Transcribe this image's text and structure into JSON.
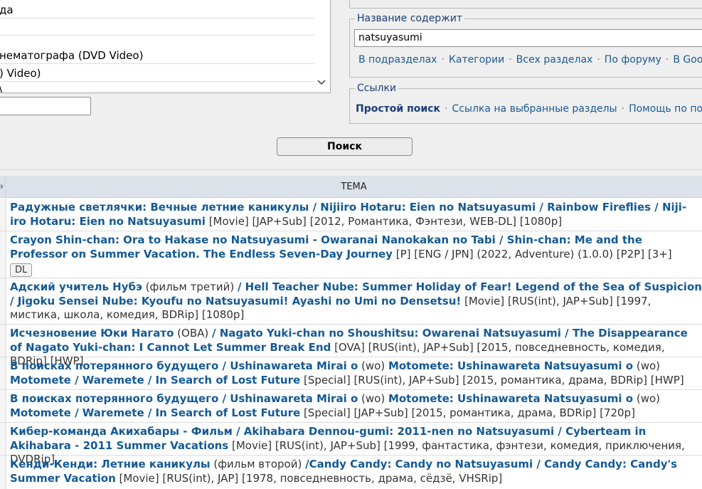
{
  "categories": {
    "items": [
      {
        "label": "да",
        "selected": false
      },
      {
        "label": "",
        "selected": false
      },
      {
        "label": "нематографа (DVD Video)",
        "selected": true
      },
      {
        "label": ") Video)",
        "selected": false
      },
      {
        "label": "\\",
        "selected": false
      }
    ]
  },
  "title_search": {
    "legend": "Название содержит",
    "value": "natsuyasumi",
    "scope_links": [
      "В подразделах",
      "Категории",
      "Всех разделах",
      "По форуму",
      "В Googl"
    ]
  },
  "links": {
    "legend": "Ссылки",
    "items": [
      "Простой поиск",
      "Ссылка на выбранные разделы",
      "Помощь по поис"
    ]
  },
  "search_button": "Поиск",
  "table": {
    "header": "ТЕМА",
    "rows": [
      {
        "parts": [
          {
            "t": "Радужные светлячки: Вечные летние каникулы / Nijiiro Hotaru: Eien no Natsuyasumi / Rainbow Fireflies / Niji-iro Hotaru: Eien no Natsuyasumi",
            "b": true
          },
          {
            "t": " [Movie] [JAP+Sub] [2012, Романтика, Фэнтези, WEB-DL] [1080p]",
            "b": false
          }
        ]
      },
      {
        "parts": [
          {
            "t": "Crayon Shin-chan: Ora to Hakase no Natsuyasumi - Owaranai Nanokakan no Tabi / Shin-chan: Me and the Professor on Summer Vacation. The Endless Seven-Day Journey",
            "b": true
          },
          {
            "t": " [P] [ENG / JPN] (2022, Adventure) (1.0.0) [P2P] [3+]",
            "b": false
          }
        ],
        "badge": "DL"
      },
      {
        "parts": [
          {
            "t": "Адский учитель Нубэ",
            "b": true
          },
          {
            "t": " (фильм третий) ",
            "b": false
          },
          {
            "t": "/ Hell Teacher Nube: Summer Holiday of Fear! Legend of the Sea of Suspicion / Jigoku Sensei Nube: Kyoufu no Natsuyasumi! Ayashi no Umi no Densetsu!",
            "b": true
          },
          {
            "t": " [Movie] [RUS(int), JAP+Sub] [1997, мистика, школа, комедия, BDRip] [1080p]",
            "b": false
          }
        ]
      },
      {
        "parts": [
          {
            "t": "Исчезновение Юки Нагато",
            "b": true
          },
          {
            "t": " (OBA) ",
            "b": false
          },
          {
            "t": "/ Nagato Yuki-chan no Shoushitsu: Owarenai Natsuyasumi / The Disappearance of Nagato Yuki-chan: I Cannot Let Summer Break End",
            "b": true
          },
          {
            "t": " [OVA] [RUS(int), JAP+Sub] [2015, повседневность, комедия, BDRip] [HWP]",
            "b": false
          }
        ]
      },
      {
        "parts": [
          {
            "t": "В поисках потерянного будущего / Ushinawareta Mirai o",
            "b": true
          },
          {
            "t": " (wo) ",
            "b": false
          },
          {
            "t": "Motomete: Ushinawareta Natsuyasumi o",
            "b": true
          },
          {
            "t": " (wo) ",
            "b": false
          },
          {
            "t": "Motomete / Waremete / In Search of Lost Future",
            "b": true
          },
          {
            "t": " [Special] [RUS(int), JAP+Sub] [2015, романтика, драма, BDRip] [HWP]",
            "b": false
          }
        ]
      },
      {
        "parts": [
          {
            "t": "В поисках потерянного будущего / Ushinawareta Mirai o",
            "b": true
          },
          {
            "t": " (wo) ",
            "b": false
          },
          {
            "t": "Motomete: Ushinawareta Natsuyasumi o",
            "b": true
          },
          {
            "t": " (wo) ",
            "b": false
          },
          {
            "t": "Motomete / Waremete / In Search of Lost Future",
            "b": true
          },
          {
            "t": " [Special] [JAP+Sub] [2015, романтика, драма, BDRip] [720p]",
            "b": false
          }
        ]
      },
      {
        "parts": [
          {
            "t": "Кибер-команда Акихабары - Фильм / Akihabara Dennou-gumi: 2011-nen no Natsuyasumi / Cyberteam in Akihabara - 2011 Summer Vacations",
            "b": true
          },
          {
            "t": " [Movie] [RUS(int), JAP+Sub] [1999, фантастика, фэнтези, комедия, приключения, DVDRip]",
            "b": false
          }
        ]
      },
      {
        "parts": [
          {
            "t": "Кенди-Кенди: Летние каникулы",
            "b": true
          },
          {
            "t": " (фильм второй) ",
            "b": false
          },
          {
            "t": "/Candy Candy: Candy no Natsuyasumi / Candy Candy: Candy's Summer Vacation",
            "b": true
          },
          {
            "t": " [Movie] [RUS(int), JAP] [1978, повседневность, драма, сёдзё, VHSRip]",
            "b": false
          }
        ]
      }
    ]
  }
}
